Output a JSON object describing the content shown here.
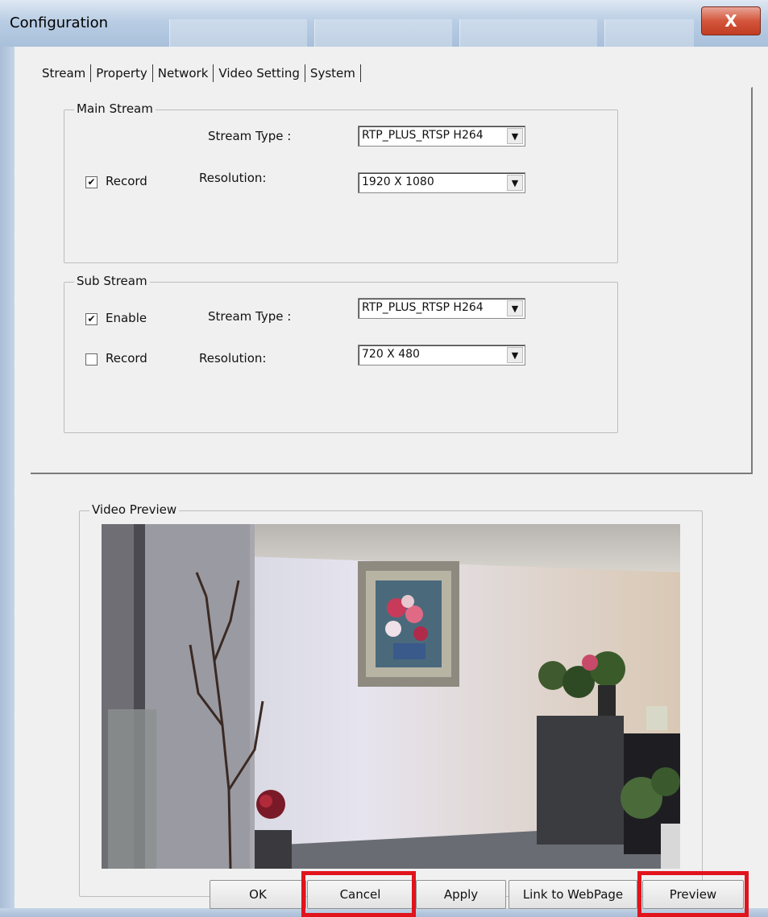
{
  "window": {
    "title": "Configuration",
    "close_glyph": "X"
  },
  "tabs": [
    {
      "label": "Stream",
      "active": true
    },
    {
      "label": "Property",
      "active": false
    },
    {
      "label": "Network",
      "active": false
    },
    {
      "label": "Video Setting",
      "active": false
    },
    {
      "label": "System",
      "active": false
    }
  ],
  "main_stream": {
    "legend": "Main Stream",
    "stream_type_label": "Stream Type :",
    "stream_type_value": "RTP_PLUS_RTSP H264",
    "record_label": "Record",
    "record_checked": true,
    "resolution_label": "Resolution:",
    "resolution_value": "1920 X 1080"
  },
  "sub_stream": {
    "legend": "Sub Stream",
    "enable_label": "Enable",
    "enable_checked": true,
    "stream_type_label": "Stream Type :",
    "stream_type_value": "RTP_PLUS_RTSP H264",
    "record_label": "Record",
    "record_checked": false,
    "resolution_label": "Resolution:",
    "resolution_value": "720 X 480"
  },
  "preview": {
    "legend": "Video Preview"
  },
  "buttons": {
    "ok": "OK",
    "cancel": "Cancel",
    "apply": "Apply",
    "link": "Link to WebPage",
    "preview": "Preview"
  },
  "check_glyph": "✔",
  "arrow_glyph": "▼",
  "colors": {
    "highlight": "#e0141c",
    "title_gradient": "#b9cde4"
  }
}
